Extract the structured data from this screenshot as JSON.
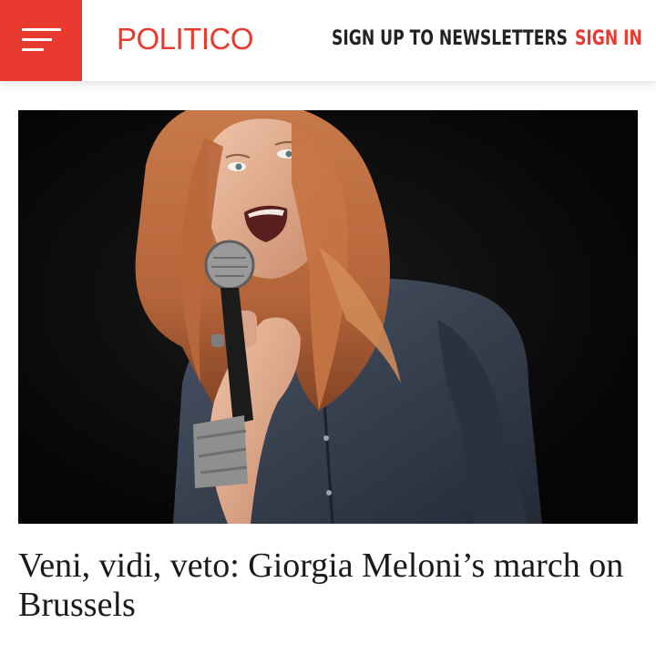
{
  "header": {
    "logo_text": "POLITICO",
    "newsletter_label": "SIGN UP TO NEWSLETTERS",
    "signin_label": "SIGN IN",
    "menu_icon": "hamburger-menu-icon",
    "colors": {
      "brand_red": "#e83a2e",
      "nav_text": "#222222"
    }
  },
  "article": {
    "image_description": "",
    "headline": "Veni, vidi, veto: Giorgia Meloni’s march on Brussels"
  }
}
